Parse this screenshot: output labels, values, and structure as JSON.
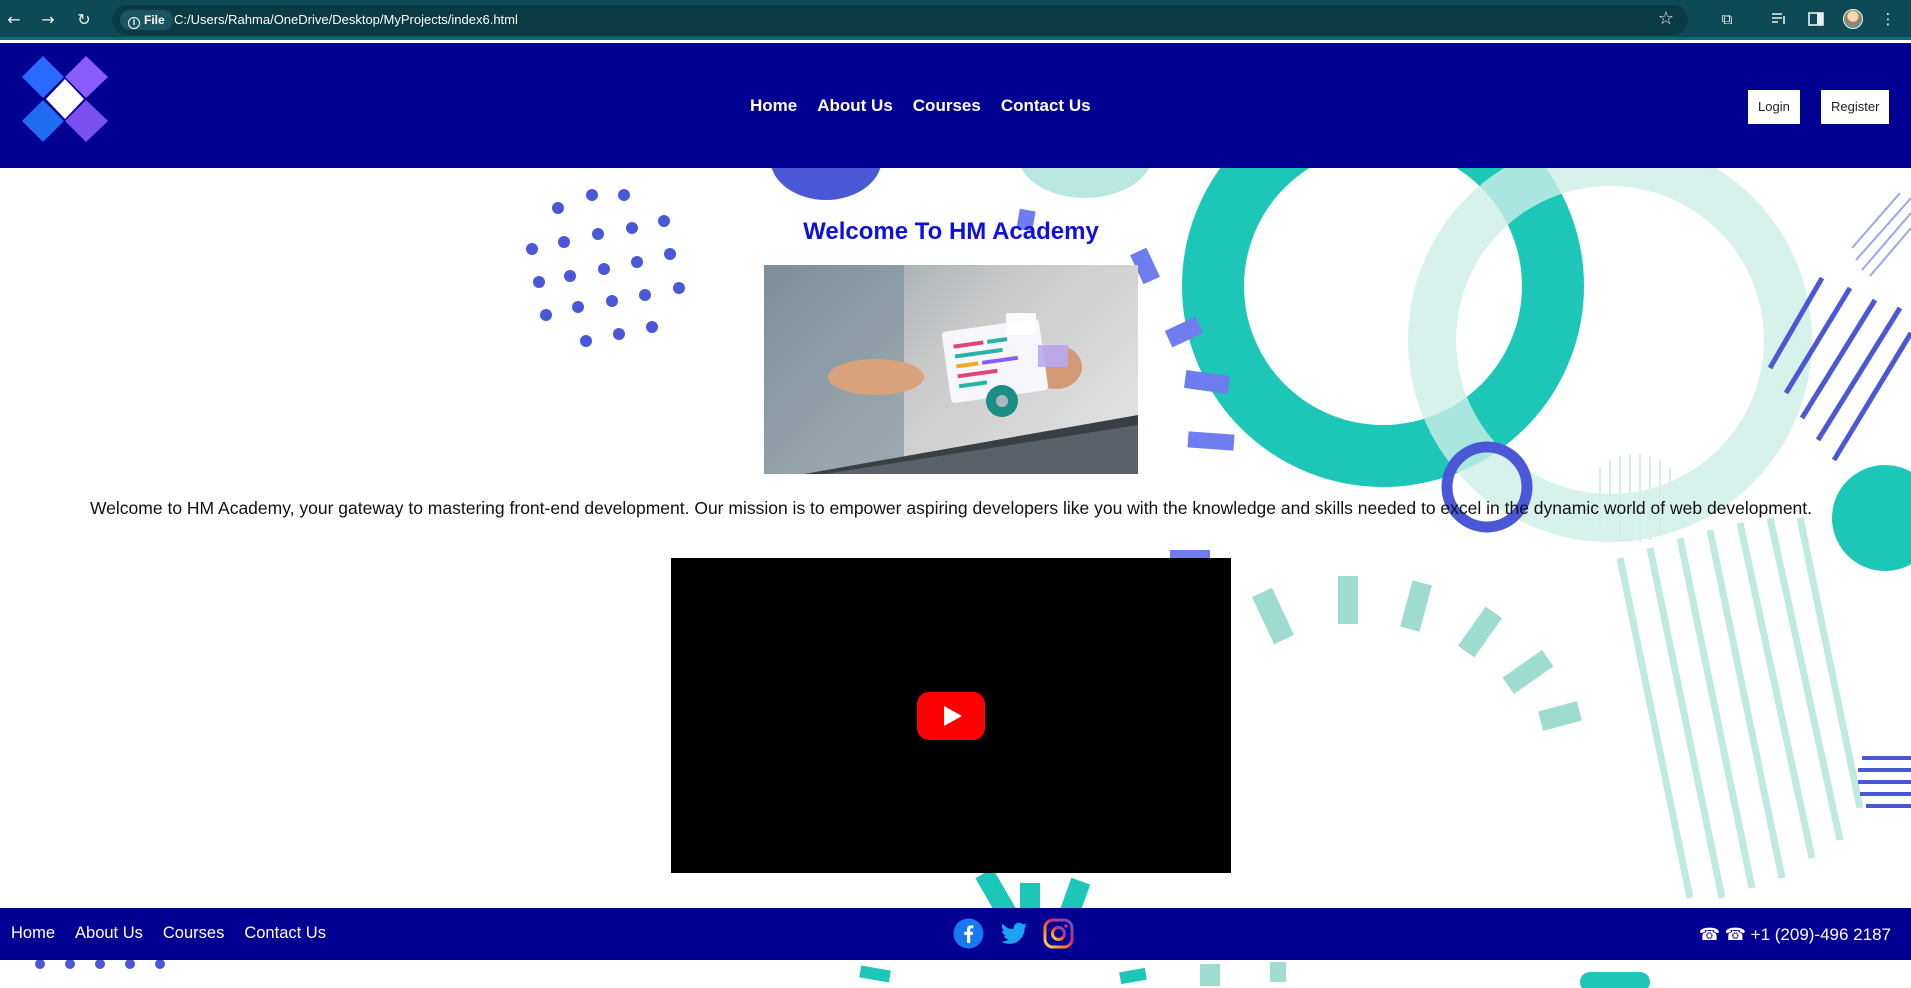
{
  "browser": {
    "url": "C:/Users/Rahma/OneDrive/Desktop/MyProjects/index6.html",
    "site_info_label": "File",
    "back_glyph": "←",
    "forward_glyph": "→",
    "reload_glyph": "↻",
    "star_glyph": "☆",
    "extensions_glyph": "⧉",
    "menu_glyph": "⋮"
  },
  "header": {
    "nav": [
      "Home",
      "About Us",
      "Courses",
      "Contact Us"
    ],
    "login_label": "Login",
    "register_label": "Register"
  },
  "main": {
    "title": "Welcome To HM Academy",
    "intro": "Welcome to HM Academy, your gateway to mastering front-end development. Our mission is to empower aspiring developers like you with the knowledge and skills needed to excel in the dynamic world of web development."
  },
  "footer": {
    "nav": [
      "Home",
      "About Us",
      "Courses",
      "Contact Us"
    ],
    "phone": "☎ ☎ +1 (209)-496 2187",
    "social": [
      "facebook-icon",
      "twitter-icon",
      "instagram-icon"
    ]
  },
  "colors": {
    "header_bg": "#020093",
    "title": "#0f10e0",
    "teal": "#1cc7b8",
    "accent_blue": "#4455dd"
  }
}
